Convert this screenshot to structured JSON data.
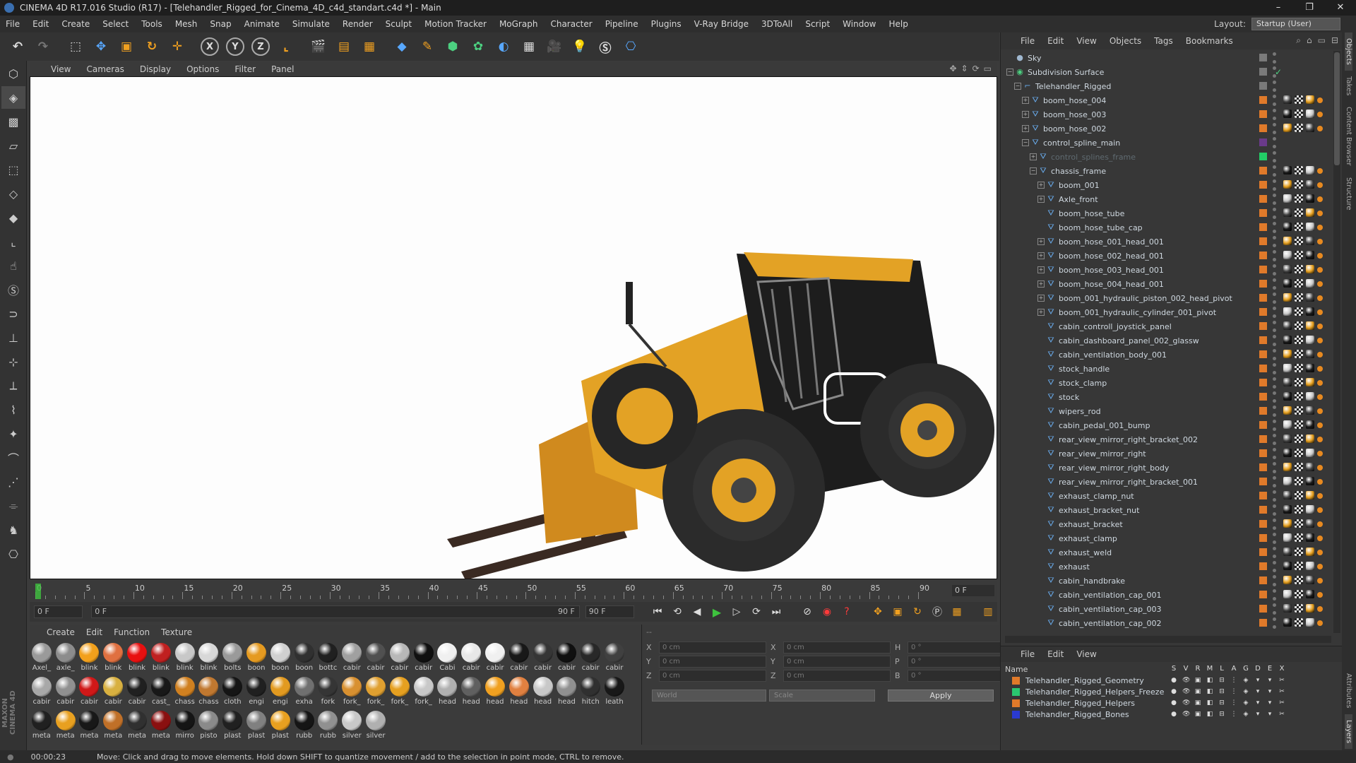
{
  "window": {
    "title": "CINEMA 4D R17.016 Studio (R17) - [Telehandler_Rigged_for_Cinema_4D_c4d_standart.c4d *] - Main",
    "minimize": "–",
    "maximize": "❐",
    "close": "✕"
  },
  "menu": [
    "File",
    "Edit",
    "Create",
    "Select",
    "Tools",
    "Mesh",
    "Snap",
    "Animate",
    "Simulate",
    "Render",
    "Sculpt",
    "Motion Tracker",
    "MoGraph",
    "Character",
    "Pipeline",
    "Plugins",
    "V-Ray Bridge",
    "3DToAll",
    "Script",
    "Window",
    "Help"
  ],
  "layout": {
    "label": "Layout:",
    "value": "Startup (User)"
  },
  "viewport_menu": [
    "View",
    "Cameras",
    "Display",
    "Options",
    "Filter",
    "Panel"
  ],
  "timeline": {
    "ticks": [
      "0",
      "5",
      "10",
      "15",
      "20",
      "25",
      "30",
      "35",
      "40",
      "45",
      "50",
      "55",
      "60",
      "65",
      "70",
      "75",
      "80",
      "85",
      "90"
    ],
    "frame_display": "0 F"
  },
  "playback": {
    "start": "0 F",
    "range_start": "0 F",
    "range_end": "90 F",
    "end": "90 F"
  },
  "material_menu": [
    "Create",
    "Edit",
    "Function",
    "Texture"
  ],
  "materials": [
    {
      "label": "Axel_",
      "color": "#9a9a9a"
    },
    {
      "label": "axle_",
      "color": "#8c8c8c"
    },
    {
      "label": "blink",
      "color": "#f2a01c"
    },
    {
      "label": "blink",
      "color": "#e07040"
    },
    {
      "label": "blink",
      "color": "#e81010"
    },
    {
      "label": "blink",
      "color": "#c02020"
    },
    {
      "label": "blink",
      "color": "#c8c8c8"
    },
    {
      "label": "blink",
      "color": "#d8d8d8"
    },
    {
      "label": "bolts",
      "color": "#9a9a9a"
    },
    {
      "label": "boon",
      "color": "#e59a20"
    },
    {
      "label": "boon",
      "color": "#d0d0d0"
    },
    {
      "label": "boon",
      "color": "#303030"
    },
    {
      "label": "bottc",
      "color": "#202020"
    },
    {
      "label": "cabir",
      "color": "#a0a0a0"
    },
    {
      "label": "cabir",
      "color": "#505050"
    },
    {
      "label": "cabir",
      "color": "#b8b8b8"
    },
    {
      "label": "cabir",
      "color": "#101010"
    },
    {
      "label": "Cabi",
      "color": "#f0f0f0"
    },
    {
      "label": "cabir",
      "color": "#e8e8e8"
    },
    {
      "label": "cabir",
      "color": "#f0f0f0"
    },
    {
      "label": "cabir",
      "color": "#181818"
    },
    {
      "label": "cabir",
      "color": "#353535"
    },
    {
      "label": "cabir",
      "color": "#101010"
    },
    {
      "label": "cabir",
      "color": "#282828"
    },
    {
      "label": "cabir",
      "color": "#404040"
    },
    {
      "label": "cabir",
      "color": "#a8a8a8"
    },
    {
      "label": "cabir",
      "color": "#909090"
    },
    {
      "label": "cabir",
      "color": "#d01818"
    },
    {
      "label": "cabir",
      "color": "#d8b040"
    },
    {
      "label": "cabir",
      "color": "#202020"
    },
    {
      "label": "cast_",
      "color": "#181818"
    },
    {
      "label": "chass",
      "color": "#d08020"
    },
    {
      "label": "chass",
      "color": "#c07830"
    },
    {
      "label": "cloth",
      "color": "#151515"
    },
    {
      "label": "engi",
      "color": "#202020"
    },
    {
      "label": "engi",
      "color": "#e29a20"
    },
    {
      "label": "exha",
      "color": "#707070"
    },
    {
      "label": "fork",
      "color": "#353535"
    },
    {
      "label": "fork_",
      "color": "#d89030"
    },
    {
      "label": "fork_",
      "color": "#e0a030"
    },
    {
      "label": "fork_",
      "color": "#e6a020"
    },
    {
      "label": "fork_",
      "color": "#c8c8c8"
    },
    {
      "label": "head",
      "color": "#b0b0b0"
    },
    {
      "label": "head",
      "color": "#606060"
    },
    {
      "label": "head",
      "color": "#f0a020"
    },
    {
      "label": "head",
      "color": "#e08040"
    },
    {
      "label": "head",
      "color": "#c8c8c8"
    },
    {
      "label": "head",
      "color": "#909090"
    },
    {
      "label": "hitch",
      "color": "#303030"
    },
    {
      "label": "leath",
      "color": "#181818"
    },
    {
      "label": "meta",
      "color": "#202020"
    },
    {
      "label": "meta",
      "color": "#e8a020"
    },
    {
      "label": "meta",
      "color": "#181818"
    },
    {
      "label": "meta",
      "color": "#c07028"
    },
    {
      "label": "meta",
      "color": "#303030"
    },
    {
      "label": "meta",
      "color": "#8a1010"
    },
    {
      "label": "mirro",
      "color": "#151515"
    },
    {
      "label": "pisto",
      "color": "#8a8a8a"
    },
    {
      "label": "plast",
      "color": "#202020"
    },
    {
      "label": "plast",
      "color": "#808080"
    },
    {
      "label": "plast",
      "color": "#e8a020"
    },
    {
      "label": "rubb",
      "color": "#151515"
    },
    {
      "label": "rubb",
      "color": "#909090"
    },
    {
      "label": "silver",
      "color": "#c8c8c8"
    },
    {
      "label": "silver",
      "color": "#b0b0b0"
    }
  ],
  "coords": {
    "rows": [
      {
        "a": "X",
        "av": "0 cm",
        "b": "X",
        "bv": "0 cm",
        "c": "H",
        "cv": "0 °"
      },
      {
        "a": "Y",
        "av": "0 cm",
        "b": "Y",
        "bv": "0 cm",
        "c": "P",
        "cv": "0 °"
      },
      {
        "a": "Z",
        "av": "0 cm",
        "b": "Z",
        "bv": "0 cm",
        "c": "B",
        "cv": "0 °"
      }
    ],
    "mode1": "World",
    "mode2": "Scale",
    "apply": "Apply",
    "header": "--"
  },
  "status": {
    "time": "00:00:23",
    "message": "Move: Click and drag to move elements. Hold down SHIFT to quantize movement / add to the selection in point mode, CTRL to remove."
  },
  "objects_menu": [
    "File",
    "Edit",
    "View",
    "Objects",
    "Tags",
    "Bookmarks"
  ],
  "objects": [
    {
      "name": "Sky",
      "depth": 0,
      "exp": "",
      "icon": "sky"
    },
    {
      "name": "Subdivision Surface",
      "depth": 0,
      "exp": "−",
      "icon": "grn"
    },
    {
      "name": "Telehandler_Rigged",
      "depth": 1,
      "exp": "−",
      "icon": "null"
    },
    {
      "name": "boom_hose_004",
      "depth": 2,
      "exp": "+",
      "icon": "poly"
    },
    {
      "name": "boom_hose_003",
      "depth": 2,
      "exp": "+",
      "icon": "poly"
    },
    {
      "name": "boom_hose_002",
      "depth": 2,
      "exp": "+",
      "icon": "poly"
    },
    {
      "name": "control_spline_main",
      "depth": 2,
      "exp": "−",
      "icon": "poly"
    },
    {
      "name": "control_splines_frame",
      "depth": 3,
      "exp": "+",
      "icon": "poly",
      "dim": true
    },
    {
      "name": "chassis_frame",
      "depth": 3,
      "exp": "−",
      "icon": "poly"
    },
    {
      "name": "boom_001",
      "depth": 4,
      "exp": "+",
      "icon": "poly"
    },
    {
      "name": "Axle_front",
      "depth": 4,
      "exp": "+",
      "icon": "poly"
    },
    {
      "name": "boom_hose_tube",
      "depth": 4,
      "exp": "",
      "icon": "poly"
    },
    {
      "name": "boom_hose_tube_cap",
      "depth": 4,
      "exp": "",
      "icon": "poly"
    },
    {
      "name": "boom_hose_001_head_001",
      "depth": 4,
      "exp": "+",
      "icon": "poly"
    },
    {
      "name": "boom_hose_002_head_001",
      "depth": 4,
      "exp": "+",
      "icon": "poly"
    },
    {
      "name": "boom_hose_003_head_001",
      "depth": 4,
      "exp": "+",
      "icon": "poly"
    },
    {
      "name": "boom_hose_004_head_001",
      "depth": 4,
      "exp": "+",
      "icon": "poly"
    },
    {
      "name": "boom_001_hydraulic_piston_002_head_pivot",
      "depth": 4,
      "exp": "+",
      "icon": "poly"
    },
    {
      "name": "boom_001_hydraulic_cylinder_001_pivot",
      "depth": 4,
      "exp": "+",
      "icon": "poly"
    },
    {
      "name": "cabin_controll_joystick_panel",
      "depth": 4,
      "exp": "",
      "icon": "poly"
    },
    {
      "name": "cabin_dashboard_panel_002_glassw",
      "depth": 4,
      "exp": "",
      "icon": "poly"
    },
    {
      "name": "cabin_ventilation_body_001",
      "depth": 4,
      "exp": "",
      "icon": "poly"
    },
    {
      "name": "stock_handle",
      "depth": 4,
      "exp": "",
      "icon": "poly"
    },
    {
      "name": "stock_clamp",
      "depth": 4,
      "exp": "",
      "icon": "poly"
    },
    {
      "name": "stock",
      "depth": 4,
      "exp": "",
      "icon": "poly"
    },
    {
      "name": "wipers_rod",
      "depth": 4,
      "exp": "",
      "icon": "poly"
    },
    {
      "name": "cabin_pedal_001_bump",
      "depth": 4,
      "exp": "",
      "icon": "poly"
    },
    {
      "name": "rear_view_mirror_right_bracket_002",
      "depth": 4,
      "exp": "",
      "icon": "poly"
    },
    {
      "name": "rear_view_mirror_right",
      "depth": 4,
      "exp": "",
      "icon": "poly"
    },
    {
      "name": "rear_view_mirror_right_body",
      "depth": 4,
      "exp": "",
      "icon": "poly"
    },
    {
      "name": "rear_view_mirror_right_bracket_001",
      "depth": 4,
      "exp": "",
      "icon": "poly"
    },
    {
      "name": "exhaust_clamp_nut",
      "depth": 4,
      "exp": "",
      "icon": "poly"
    },
    {
      "name": "exhaust_bracket_nut",
      "depth": 4,
      "exp": "",
      "icon": "poly"
    },
    {
      "name": "exhaust_bracket",
      "depth": 4,
      "exp": "",
      "icon": "poly"
    },
    {
      "name": "exhaust_clamp",
      "depth": 4,
      "exp": "",
      "icon": "poly"
    },
    {
      "name": "exhaust_weld",
      "depth": 4,
      "exp": "",
      "icon": "poly"
    },
    {
      "name": "exhaust",
      "depth": 4,
      "exp": "",
      "icon": "poly"
    },
    {
      "name": "cabin_handbrake",
      "depth": 4,
      "exp": "",
      "icon": "poly"
    },
    {
      "name": "cabin_ventilation_cap_001",
      "depth": 4,
      "exp": "",
      "icon": "poly"
    },
    {
      "name": "cabin_ventilation_cap_003",
      "depth": 4,
      "exp": "",
      "icon": "poly"
    },
    {
      "name": "cabin_ventilation_cap_002",
      "depth": 4,
      "exp": "",
      "icon": "poly"
    }
  ],
  "layers_menu": [
    "File",
    "Edit",
    "View"
  ],
  "layers_header": {
    "name": "Name",
    "cols": [
      "S",
      "V",
      "R",
      "M",
      "L",
      "A",
      "G",
      "D",
      "E",
      "X"
    ]
  },
  "layers": [
    {
      "name": "Telehandler_Rigged_Geometry",
      "color": "#e07a2a"
    },
    {
      "name": "Telehandler_Rigged_Helpers_Freeze",
      "color": "#2ac870"
    },
    {
      "name": "Telehandler_Rigged_Helpers",
      "color": "#e07a2a"
    },
    {
      "name": "Telehandler_Rigged_Bones",
      "color": "#2a3ad0"
    }
  ],
  "side_tabs": [
    "Objects",
    "Takes",
    "Content Browser",
    "Structure",
    "Attributes",
    "Layers"
  ],
  "brand": "MAXON CINEMA 4D"
}
